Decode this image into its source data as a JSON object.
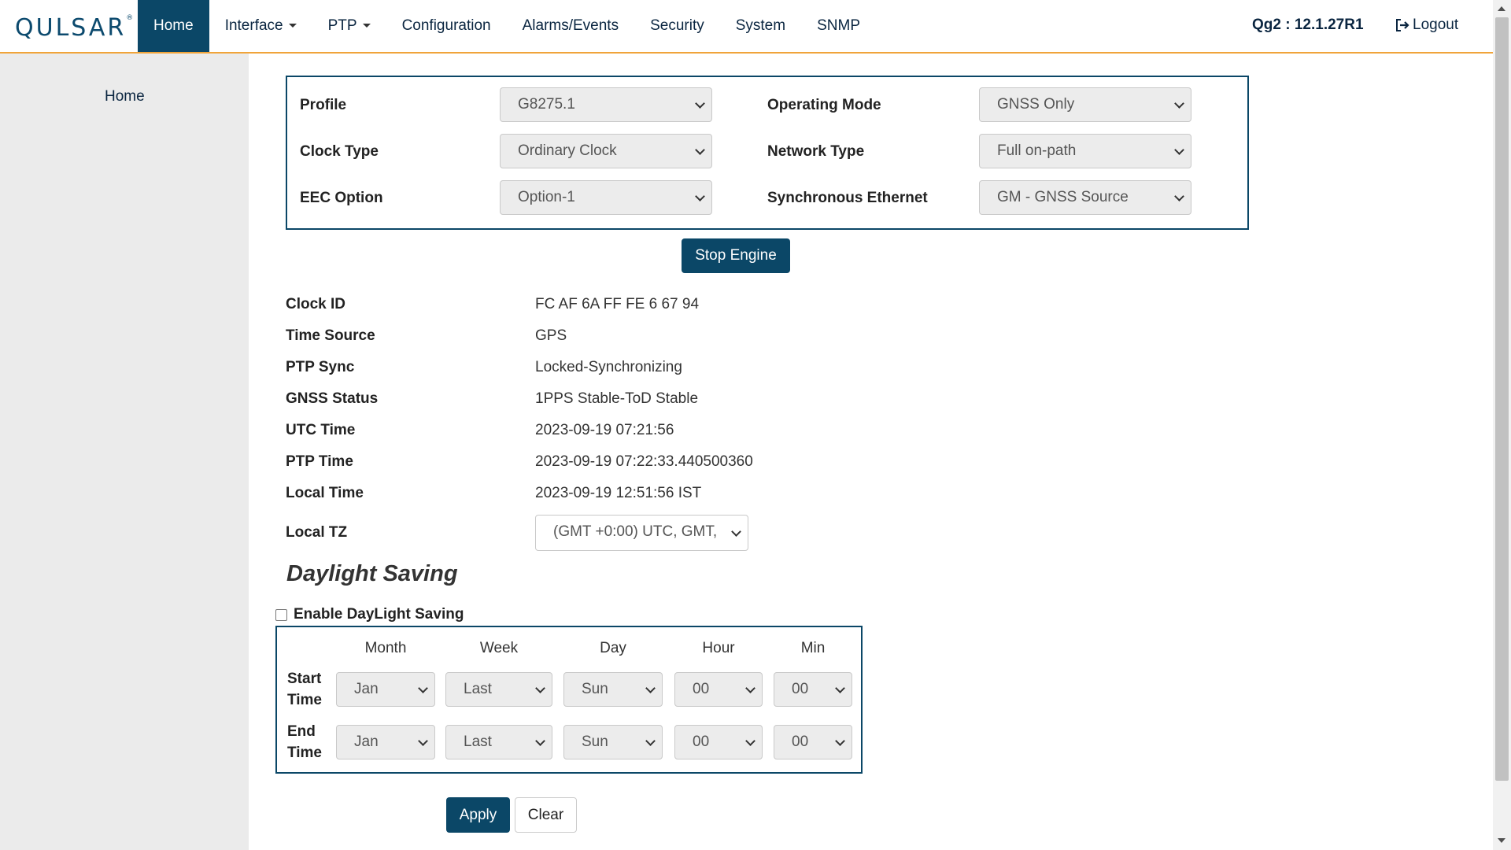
{
  "brand": {
    "logo_text": "QULSAR",
    "logo_mark": "®"
  },
  "nav": {
    "home": "Home",
    "interface": "Interface",
    "ptp": "PTP",
    "configuration": "Configuration",
    "alarms": "Alarms/Events",
    "security": "Security",
    "system": "System",
    "snmp": "SNMP"
  },
  "header": {
    "version": "Qg2 : 12.1.27R1",
    "logout": "Logout"
  },
  "sidebar": {
    "home": "Home"
  },
  "config": {
    "profile_label": "Profile",
    "profile_value": "G8275.1",
    "clock_type_label": "Clock Type",
    "clock_type_value": "Ordinary Clock",
    "eec_label": "EEC Option",
    "eec_value": "Option-1",
    "op_mode_label": "Operating Mode",
    "op_mode_value": "GNSS Only",
    "network_type_label": "Network Type",
    "network_type_value": "Full on-path",
    "synce_label": "Synchronous Ethernet",
    "synce_value": "GM - GNSS Source"
  },
  "engine_button": "Stop Engine",
  "status": {
    "clock_id_label": "Clock ID",
    "clock_id": "FC AF 6A FF FE 6 67 94",
    "time_source_label": "Time Source",
    "time_source": "GPS",
    "ptp_sync_label": "PTP Sync",
    "ptp_sync": "Locked-Synchronizing",
    "gnss_status_label": "GNSS Status",
    "gnss_status": "1PPS Stable-ToD Stable",
    "utc_label": "UTC Time",
    "utc": "2023-09-19 07:21:56",
    "ptp_time_label": "PTP Time",
    "ptp_time": "2023-09-19 07:22:33.440500360",
    "local_time_label": "Local Time",
    "local_time": "2023-09-19 12:51:56 IST",
    "local_tz_label": "Local TZ",
    "local_tz": "(GMT +0:00) UTC, GMT,"
  },
  "dst": {
    "title": "Daylight Saving",
    "enable_label": "Enable DayLight Saving",
    "enabled": false,
    "columns": [
      "Month",
      "Week",
      "Day",
      "Hour",
      "Min"
    ],
    "start_label_1": "Start",
    "start_label_2": "Time",
    "end_label_1": "End",
    "end_label_2": "Time",
    "start": {
      "month": "Jan",
      "week": "Last",
      "day": "Sun",
      "hour": "00",
      "min": "00"
    },
    "end": {
      "month": "Jan",
      "week": "Last",
      "day": "Sun",
      "hour": "00",
      "min": "00"
    }
  },
  "actions": {
    "apply": "Apply",
    "clear": "Clear"
  },
  "colors": {
    "accent": "#0b4767",
    "header_border": "#f0a43a",
    "sidebar_bg": "#ebebeb"
  }
}
